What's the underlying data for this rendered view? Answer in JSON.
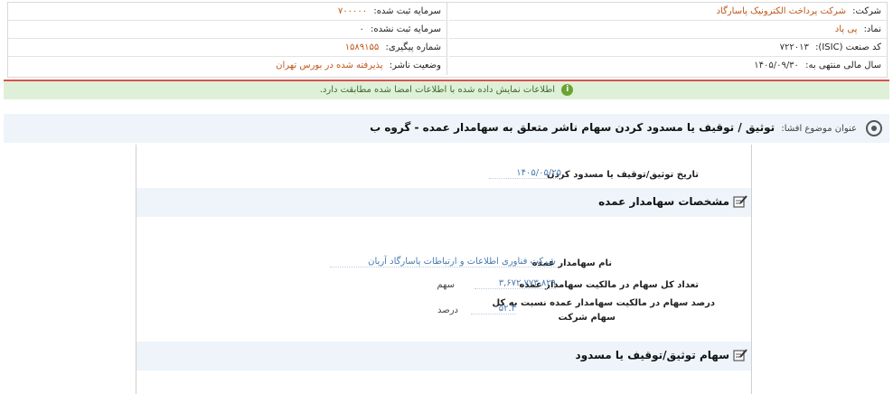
{
  "info": {
    "company_label": "شرکت:",
    "company_value": "شرکت پرداخت الکترونیک پاسارگاد",
    "reg_capital_label": "سرمایه ثبت شده:",
    "reg_capital_value": "۷۰۰۰۰۰",
    "symbol_label": "نماد:",
    "symbol_value": "پی پاد",
    "unreg_capital_label": "سرمایه ثبت نشده:",
    "unreg_capital_value": "۰",
    "isic_label": "کد صنعت (ISIC):",
    "isic_value": "۷۲۲۰۱۳",
    "tracking_label": "شماره پیگیری:",
    "tracking_value": "۱۵۸۹۱۵۵",
    "fiscal_label": "سال مالی منتهی به:",
    "fiscal_value": "۱۴۰۵/۰۹/۳۰",
    "status_label": "وضعیت ناشر:",
    "status_value": "پذیرفته شده در بورس تهران"
  },
  "banner": {
    "text": "اطلاعات نمایش داده شده با اطلاعات امضا شده مطابقت دارد."
  },
  "subject": {
    "label": "عنوان موضوع افشا:",
    "title": "توثیق / توقیف یا مسدود کردن سهام ناشر متعلق به سهامدار عمده - گروه ب"
  },
  "date_field": {
    "label": "تاریخ توثیق/توقیف یا مسدود کردن",
    "value": "۱۴۰۵/۰۵/۲۵"
  },
  "section1": {
    "title": "مشخصات سهامدار عمده"
  },
  "shareholder": {
    "name_label": "نام سهامدار عمده",
    "name_value": "شرکت فناوری اطلاعات و ارتباطات پاسارگاد آریان",
    "total_label": "تعداد کل سهام در مالکیت سهامدار عمده",
    "total_value": "۳,۶۷۲,۷۷۳,۸۲۹",
    "total_unit": "سهم",
    "percent_label_line1": "درصد سهام در مالکیت سهامدار عمده نسبت به کل",
    "percent_label_line2": "سهام شرکت",
    "percent_value": "۵۲.۴",
    "percent_unit": "درصد"
  },
  "section2": {
    "title": "سهام توثیق/توقیف یا مسدود"
  }
}
